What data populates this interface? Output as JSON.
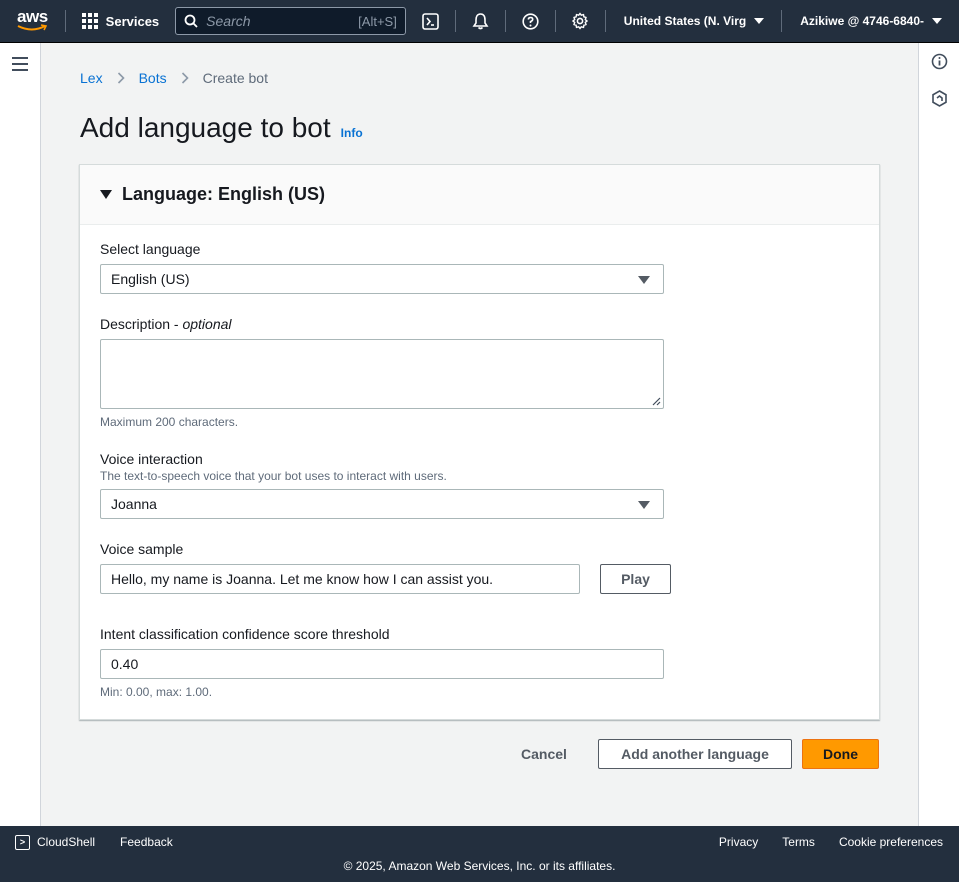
{
  "nav": {
    "logo_text": "aws",
    "services_label": "Services",
    "search_placeholder": "Search",
    "search_shortcut": "[Alt+S]",
    "region": "United States (N. Virg",
    "account": "Azikiwe @ 4746-6840-"
  },
  "breadcrumb": {
    "items": [
      "Lex",
      "Bots"
    ],
    "current": "Create bot"
  },
  "page": {
    "title": "Add language to bot",
    "info": "Info"
  },
  "panel": {
    "header": "Language: English (US)",
    "select_language": {
      "label": "Select language",
      "value": "English (US)"
    },
    "description": {
      "label": "Description - ",
      "optional": "optional",
      "value": "",
      "hint": "Maximum 200 characters."
    },
    "voice_interaction": {
      "label": "Voice interaction",
      "description": "The text-to-speech voice that your bot uses to interact with users.",
      "value": "Joanna"
    },
    "voice_sample": {
      "label": "Voice sample",
      "value": "Hello, my name is Joanna. Let me know how I can assist you.",
      "play_label": "Play"
    },
    "confidence": {
      "label": "Intent classification confidence score threshold",
      "value": "0.40",
      "hint": "Min: 0.00, max: 1.00."
    }
  },
  "actions": {
    "cancel": "Cancel",
    "add_another": "Add another language",
    "done": "Done"
  },
  "footer": {
    "cloudshell": "CloudShell",
    "feedback": "Feedback",
    "privacy": "Privacy",
    "terms": "Terms",
    "cookie": "Cookie preferences",
    "copyright": "© 2025, Amazon Web Services, Inc. or its affiliates."
  },
  "colors": {
    "nav_bg": "#232f3e",
    "link": "#0972d3",
    "primary_button": "#ff9900"
  }
}
